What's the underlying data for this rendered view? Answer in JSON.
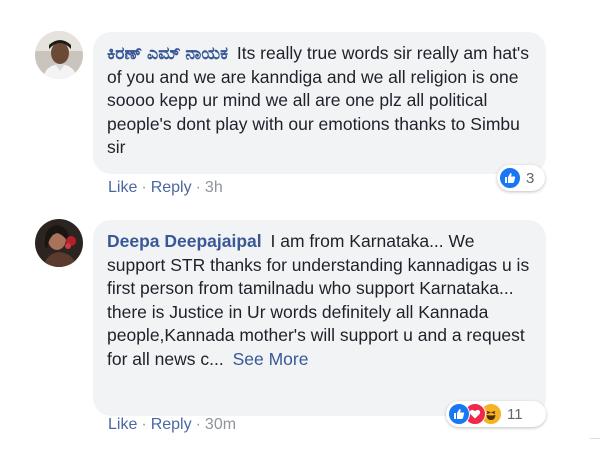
{
  "comments": [
    {
      "author": "ಕಿರಣ್ ಎಮ್ ನಾಯಕ",
      "text": "Its really true words sir really am hat's of you and we are kanndiga and we all religion is one soooo kepp ur mind we all are one plz all political people's dont play with our emotions thanks to Simbu sir",
      "actions": {
        "like": "Like",
        "reply": "Reply",
        "time": "3h"
      },
      "reactions": {
        "count": "3",
        "icons": [
          "like-icon"
        ]
      }
    },
    {
      "author": "Deepa Deepajaipal",
      "text": "I am from Karnataka... We support STR thanks for understanding kannadigas u is first person from tamilnadu who support Karnataka... there is Justice in Ur words definitely all Kannada people,Kannada mother's will support u and a request for all news c...",
      "see_more": "See More",
      "actions": {
        "like": "Like",
        "reply": "Reply",
        "time": "30m"
      },
      "reactions": {
        "count": "11",
        "icons": [
          "like-icon",
          "love-icon",
          "haha-icon"
        ]
      }
    }
  ],
  "separator": "·",
  "colors": {
    "link": "#385898",
    "action": "#4b67a1",
    "bubble": "#f2f3f5",
    "like": "#1877f2",
    "love": "#f0284a",
    "haha": "#f7b125"
  }
}
